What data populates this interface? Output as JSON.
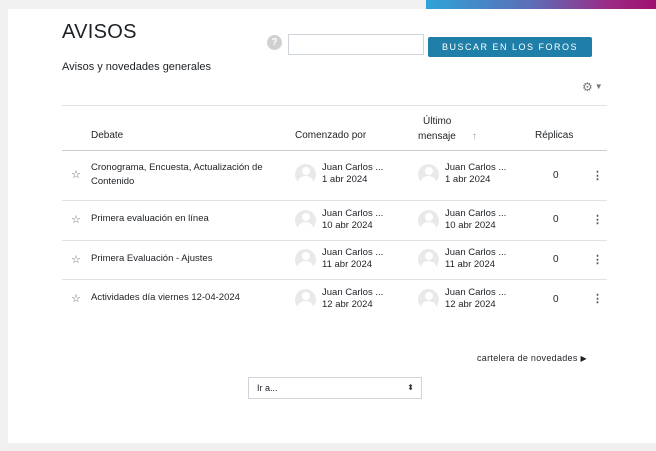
{
  "page": {
    "title": "AVISOS",
    "subtitle": "Avisos y novedades generales"
  },
  "search": {
    "help_icon": "?",
    "value": "",
    "button_label": "BUSCAR EN LOS FOROS"
  },
  "settings": {
    "icon": "gear-icon",
    "glyph": "⚙"
  },
  "table": {
    "headers": {
      "debate": "Debate",
      "started_by": "Comenzado por",
      "last_post_line1": "Último",
      "last_post_line2": "mensaje",
      "replies": "Réplicas"
    },
    "rows": [
      {
        "subject": "Cronograma, Encuesta, Actualización de Contenido",
        "started_name": "Juan Carlos ...",
        "started_date": "1 abr 2024",
        "last_name": "Juan Carlos ...",
        "last_date": "1 abr 2024",
        "replies": "0"
      },
      {
        "subject": "Primera evaluación en línea",
        "started_name": "Juan Carlos ...",
        "started_date": "10 abr 2024",
        "last_name": "Juan Carlos ...",
        "last_date": "10 abr 2024",
        "replies": "0"
      },
      {
        "subject": "Primera Evaluación - Ajustes",
        "started_name": "Juan Carlos ...",
        "started_date": "11 abr 2024",
        "last_name": "Juan Carlos ...",
        "last_date": "11 abr 2024",
        "replies": "0"
      },
      {
        "subject": "Actividades día viernes 12-04-2024",
        "started_name": "Juan Carlos ...",
        "started_date": "12 abr 2024",
        "last_name": "Juan Carlos ...",
        "last_date": "12 abr 2024",
        "replies": "0"
      }
    ]
  },
  "footer": {
    "archive_link": "cartelera de novedades",
    "jump_select_value": "Ir a..."
  },
  "colors": {
    "accent_button": "#1f7fa8",
    "page_bg": "#f0f0f0"
  }
}
